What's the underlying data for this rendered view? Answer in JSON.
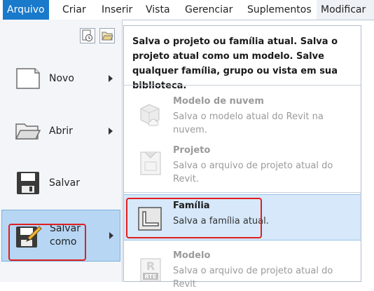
{
  "menubar": {
    "tabs": [
      {
        "label": "Arquivo"
      },
      {
        "label": "Criar"
      },
      {
        "label": "Inserir"
      },
      {
        "label": "Vista"
      },
      {
        "label": "Gerenciar"
      },
      {
        "label": "Suplementos"
      },
      {
        "label": "Modificar"
      }
    ]
  },
  "left_menu": {
    "quick_icons": [
      "recent-documents-icon",
      "open-documents-icon"
    ],
    "items": [
      {
        "label": "Novo",
        "icon": "new-document-icon"
      },
      {
        "label": "Abrir",
        "icon": "open-folder-icon"
      },
      {
        "label": "Salvar",
        "icon": "save-icon"
      },
      {
        "label": "Salvar",
        "label_line2": "como",
        "icon": "save-as-icon"
      }
    ]
  },
  "submenu": {
    "description": "Salva o projeto ou família atual. Salva o projeto atual como um modelo. Salve qualquer família, grupo ou vista em sua biblioteca.",
    "items": [
      {
        "title": "Modelo de nuvem",
        "text": "Salva o modelo atual do Revit na nuvem.",
        "icon": "cloud-model-icon"
      },
      {
        "title": "Projeto",
        "text": "Salva o arquivo de projeto atual do Revit.",
        "icon": "project-icon"
      },
      {
        "title": "Família",
        "text": "Salva a família atual.",
        "icon": "family-icon"
      },
      {
        "title": "Modelo",
        "text": "Salva o arquivo de projeto atual do Revit",
        "icon": "template-rte-icon",
        "icon_text": "RTE"
      }
    ]
  },
  "colors": {
    "accent": "#1979ca",
    "highlight": "#e01e1e",
    "hover": "#b6d6f3",
    "selected": "#d6e8fa"
  }
}
